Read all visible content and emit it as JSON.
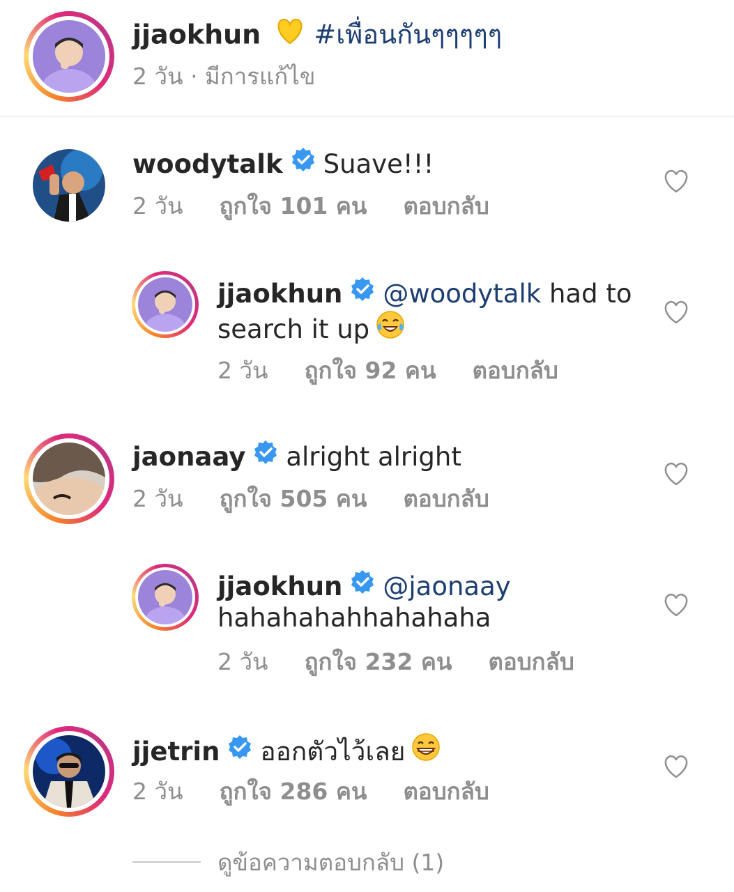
{
  "post": {
    "username": "jjaokhun",
    "hashtag": "#เพื่อนกันๆๆๆๆๆ",
    "meta": "2 วัน · มีการแก้ไข",
    "emoji": "yellow-heart"
  },
  "comments": [
    {
      "username": "woodytalk",
      "text": "Suave!!!",
      "time": "2 วัน",
      "likes": "ถูกใจ 101 คน",
      "reply": "ตอบกลับ"
    },
    {
      "username": "jjaokhun",
      "mention": "@woodytalk",
      "text_a": " had to",
      "text_b": "search it up",
      "time": "2 วัน",
      "likes": "ถูกใจ 92 คน",
      "reply": "ตอบกลับ"
    },
    {
      "username": "jaonaay",
      "text": "alright alright",
      "time": "2 วัน",
      "likes": "ถูกใจ 505 คน",
      "reply": "ตอบกลับ"
    },
    {
      "username": "jjaokhun",
      "mention": "@jaonaay",
      "text_b": "hahahahahhahahaha",
      "time": "2 วัน",
      "likes": "ถูกใจ 232 คน",
      "reply": "ตอบกลับ"
    },
    {
      "username": "jjetrin",
      "text": "ออกตัวไว้เลย",
      "time": "2 วัน",
      "likes": "ถูกใจ 286 คน",
      "reply": "ตอบกลับ"
    }
  ],
  "view_replies": "ดูข้อความตอบกลับ (1)",
  "colors": {
    "accent": "#3897f0",
    "mention": "#1c3e72",
    "muted": "#8e8e8e",
    "text": "#262626"
  }
}
